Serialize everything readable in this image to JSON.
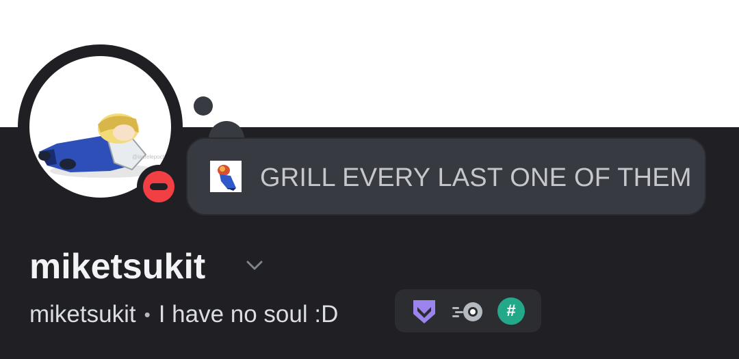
{
  "profile": {
    "display_name": "miketsukit",
    "username": "miketsukit",
    "separator": "•",
    "pronouns_bio": "I have no soul :D",
    "status": "do-not-disturb",
    "custom_status": {
      "emoji": "custom-emoji",
      "text": "GRILL EVERY LAST ONE OF THEM"
    }
  },
  "badges": [
    {
      "icon": "hypesquad-bravery-icon",
      "color": "#9c84ef"
    },
    {
      "icon": "nitro-icon",
      "color": "#b5bac1"
    },
    {
      "icon": "hash-icon",
      "label": "#",
      "color": "#23a88a"
    }
  ],
  "colors": {
    "background": "#1f1f24",
    "banner": "#ffffff",
    "status_dnd": "#f23f43",
    "bubble": "#383a42"
  }
}
